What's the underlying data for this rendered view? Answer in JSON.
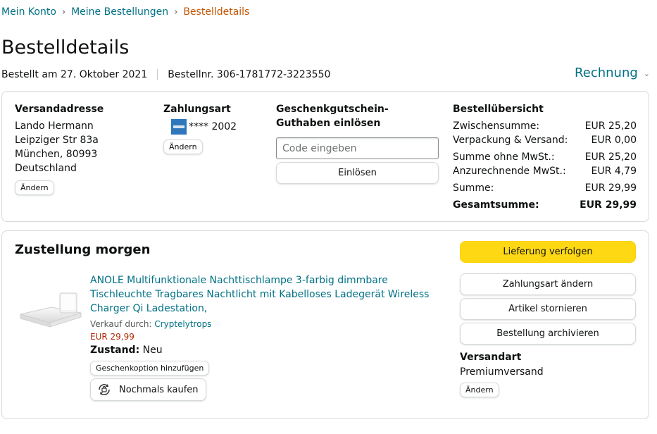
{
  "breadcrumb": {
    "items": [
      "Mein Konto",
      "Meine Bestellungen"
    ],
    "current": "Bestelldetails"
  },
  "page": {
    "title": "Bestelldetails",
    "ordered_on": "Bestellt am 27. Oktober 2021",
    "order_number": "Bestellnr. 306-1781772-3223550",
    "invoice_label": "Rechnung"
  },
  "shipping_address": {
    "title": "Versandadresse",
    "lines": [
      "Lando Hermann",
      "Leipziger Str 83a",
      "München, 80993",
      "Deutschland"
    ],
    "change_label": "Ändern"
  },
  "payment": {
    "title": "Zahlungsart",
    "card_icon": "amex-card-icon",
    "card_suffix": "**** 2002",
    "change_label": "Ändern"
  },
  "gift_card": {
    "title": "Geschenkgutschein-Guthaben einlösen",
    "placeholder": "Code eingeben",
    "redeem_label": "Einlösen"
  },
  "summary": {
    "title": "Bestellübersicht",
    "rows": [
      {
        "label": "Zwischensumme:",
        "value": "EUR 25,20"
      },
      {
        "label": "Verpackung & Versand:",
        "value": "EUR 0,00"
      },
      {
        "label": "Summe ohne MwSt.:",
        "value": "EUR 25,20"
      },
      {
        "label": "Anzurechnende MwSt.:",
        "value": "EUR 4,79"
      },
      {
        "label": "Summe:",
        "value": "EUR 29,99"
      },
      {
        "label": "Gesamtsumme:",
        "value": "EUR 29,99"
      }
    ]
  },
  "delivery": {
    "title": "Zustellung morgen",
    "product": {
      "title": "ANOLE Multifunktionale Nachttischlampe 3-farbig dimmbare Tischleuchte Tragbares Nachtlicht mit Kabelloses Ladegerät Wireless Charger Qi Ladestation,",
      "sold_by_label": "Verkauf durch:",
      "seller": "Cryptelytrops",
      "price": "EUR 29,99",
      "condition_label": "Zustand:",
      "condition": "Neu",
      "gift_option_label": "Geschenkoption hinzufügen",
      "buy_again_label": "Nochmals kaufen"
    },
    "actions": {
      "track": "Lieferung verfolgen",
      "change_payment": "Zahlungsart ändern",
      "cancel": "Artikel stornieren",
      "archive": "Bestellung archivieren"
    },
    "shipping_method": {
      "title": "Versandart",
      "value": "Premiumversand",
      "change_label": "Ändern"
    }
  },
  "colors": {
    "link": "#007185",
    "breadcrumb_current": "#c45500",
    "primary_button": "#ffd814",
    "price": "#b12704",
    "amex": "#2e77bb"
  }
}
